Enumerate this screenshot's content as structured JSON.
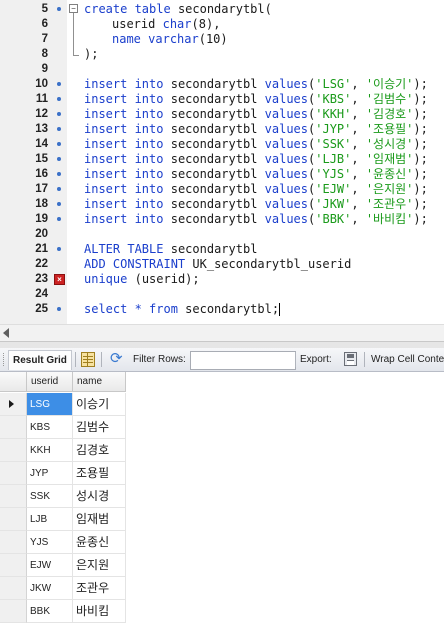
{
  "editor": {
    "lines": [
      {
        "n": "5"
      },
      {
        "n": "6"
      },
      {
        "n": "7"
      },
      {
        "n": "8"
      },
      {
        "n": "9"
      },
      {
        "n": "10"
      },
      {
        "n": "11"
      },
      {
        "n": "12"
      },
      {
        "n": "13"
      },
      {
        "n": "14"
      },
      {
        "n": "15"
      },
      {
        "n": "16"
      },
      {
        "n": "17"
      },
      {
        "n": "18"
      },
      {
        "n": "19"
      },
      {
        "n": "20"
      },
      {
        "n": "21"
      },
      {
        "n": "22"
      },
      {
        "n": "23"
      },
      {
        "n": "24"
      },
      {
        "n": "25"
      }
    ],
    "sql": {
      "create_kw": "create table",
      "table": "secondarytbl",
      "open": "(",
      "col1_name": "userid",
      "col1_type": "char",
      "col1_len": "8",
      "col2_name": "name",
      "col2_type": "varchar",
      "col2_len": "10",
      "close": ");",
      "insert_kw": "insert into",
      "values_kw": "values",
      "inserts": [
        {
          "id": "'LSG'",
          "name": "'이승기'"
        },
        {
          "id": "'KBS'",
          "name": "'김범수'"
        },
        {
          "id": "'KKH'",
          "name": "'김경호'"
        },
        {
          "id": "'JYP'",
          "name": "'조용필'"
        },
        {
          "id": "'SSK'",
          "name": "'성시경'"
        },
        {
          "id": "'LJB'",
          "name": "'임재범'"
        },
        {
          "id": "'YJS'",
          "name": "'윤종신'"
        },
        {
          "id": "'EJW'",
          "name": "'은지원'"
        },
        {
          "id": "'JKW'",
          "name": "'조관우'"
        },
        {
          "id": "'BBK'",
          "name": "'바비킴'"
        }
      ],
      "alter_kw": "ALTER TABLE",
      "add_kw": "ADD CONSTRAINT",
      "constraint_name": "UK_secondarytbl_userid",
      "unique_kw": "unique",
      "unique_arg": "(userid);",
      "select_kw": "select * from",
      "select_end": ";"
    },
    "error_mark": "×"
  },
  "toolbar": {
    "result_grid_label": "Result Grid",
    "filter_rows_label": "Filter Rows:",
    "filter_rows_value": "",
    "export_label": "Export:",
    "wrap_label": "Wrap Cell Conte"
  },
  "grid": {
    "columns": [
      "userid",
      "name"
    ],
    "rows": [
      {
        "userid": "LSG",
        "name": "이승기"
      },
      {
        "userid": "KBS",
        "name": "김범수"
      },
      {
        "userid": "KKH",
        "name": "김경호"
      },
      {
        "userid": "JYP",
        "name": "조용필"
      },
      {
        "userid": "SSK",
        "name": "성시경"
      },
      {
        "userid": "LJB",
        "name": "임재범"
      },
      {
        "userid": "YJS",
        "name": "윤종신"
      },
      {
        "userid": "EJW",
        "name": "은지원"
      },
      {
        "userid": "JKW",
        "name": "조관우"
      },
      {
        "userid": "BBK",
        "name": "바비킴"
      }
    ],
    "selected_index": 0
  },
  "colors": {
    "keyword": "#1a3ecc",
    "string": "#1a9a1a",
    "selection": "#3d8ee6"
  }
}
